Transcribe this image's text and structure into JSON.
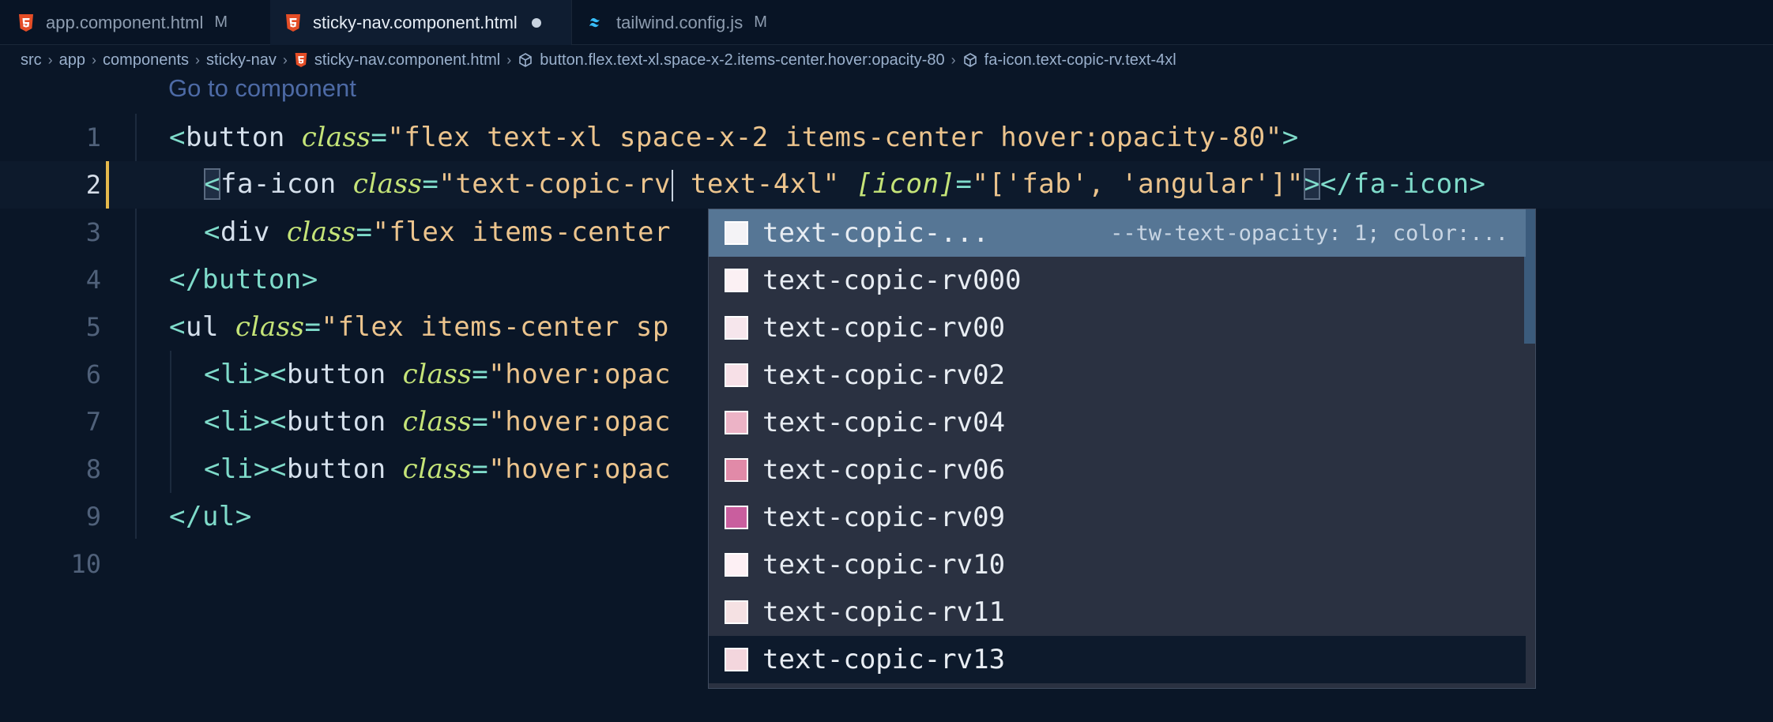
{
  "tabs": [
    {
      "label": "app.component.html",
      "badge": "M",
      "icon": "html5-icon"
    },
    {
      "label": "sticky-nav.component.html",
      "icon": "html5-icon",
      "unsaved": true
    },
    {
      "label": "tailwind.config.js",
      "badge": "M",
      "icon": "tailwind-icon"
    }
  ],
  "breadcrumb": {
    "items": [
      "src",
      "app",
      "components",
      "sticky-nav"
    ],
    "file": "sticky-nav.component.html",
    "symbol1": "button.flex.text-xl.space-x-2.items-center.hover:opacity-80",
    "symbol2": "fa-icon.text-copic-rv.text-4xl"
  },
  "codelens": "Go to component",
  "lines": [
    "1",
    "2",
    "3",
    "4",
    "5",
    "6",
    "7",
    "8",
    "9",
    "10"
  ],
  "code": {
    "l1": {
      "open": "<",
      "tag": "button",
      "attr": "class",
      "eq": "=",
      "val": "\"flex text-xl space-x-2 items-center hover:opacity-80\"",
      "close": ">"
    },
    "l2": {
      "open": "<",
      "tag": "fa-icon",
      "attr": "class",
      "eq": "=",
      "val1": "\"text-copic-rv",
      "val2": " text-4xl\"",
      "prop": "[icon]",
      "eq2": "=",
      "val3": "\"['fab', 'angular']\"",
      "close": ">",
      "endtag": "</fa-icon>"
    },
    "l3": {
      "open": "<",
      "tag": "div",
      "attr": "class",
      "eq": "=",
      "val": "\"flex items-center"
    },
    "l4": {
      "endtag": "</button>"
    },
    "l5": {
      "open": "<",
      "tag": "ul",
      "attr": "class",
      "eq": "=",
      "val": "\"flex items-center sp"
    },
    "l6": {
      "pre": "<li><",
      "tag": "button",
      "attr": "class",
      "eq": "=",
      "val": "\"hover:opac"
    },
    "l7": {
      "pre": "<li><",
      "tag": "button",
      "attr": "class",
      "eq": "=",
      "val": "\"hover:opac"
    },
    "l8": {
      "pre": "<li><",
      "tag": "button",
      "attr": "class",
      "eq": "=",
      "val": "\"hover:opac"
    },
    "l9": {
      "endtag": "</ul>"
    }
  },
  "suggestions": [
    {
      "label": "text-copic-...",
      "detail": "--tw-text-opacity: 1; color:...",
      "color": "#f4f3f6"
    },
    {
      "label": "text-copic-rv000",
      "color": "#fbf0f3"
    },
    {
      "label": "text-copic-rv00",
      "color": "#f6e6ec"
    },
    {
      "label": "text-copic-rv02",
      "color": "#f7e0e7"
    },
    {
      "label": "text-copic-rv04",
      "color": "#ecb3c6"
    },
    {
      "label": "text-copic-rv06",
      "color": "#e18aa8"
    },
    {
      "label": "text-copic-rv09",
      "color": "#c95e9e"
    },
    {
      "label": "text-copic-rv10",
      "color": "#fdf0f4"
    },
    {
      "label": "text-copic-rv11",
      "color": "#f5e1e3"
    },
    {
      "label": "text-copic-rv13",
      "color": "#f3d6dd"
    }
  ],
  "colors": {
    "accent": "#e5b94c",
    "selection": "#567695",
    "background": "#0a1627"
  }
}
